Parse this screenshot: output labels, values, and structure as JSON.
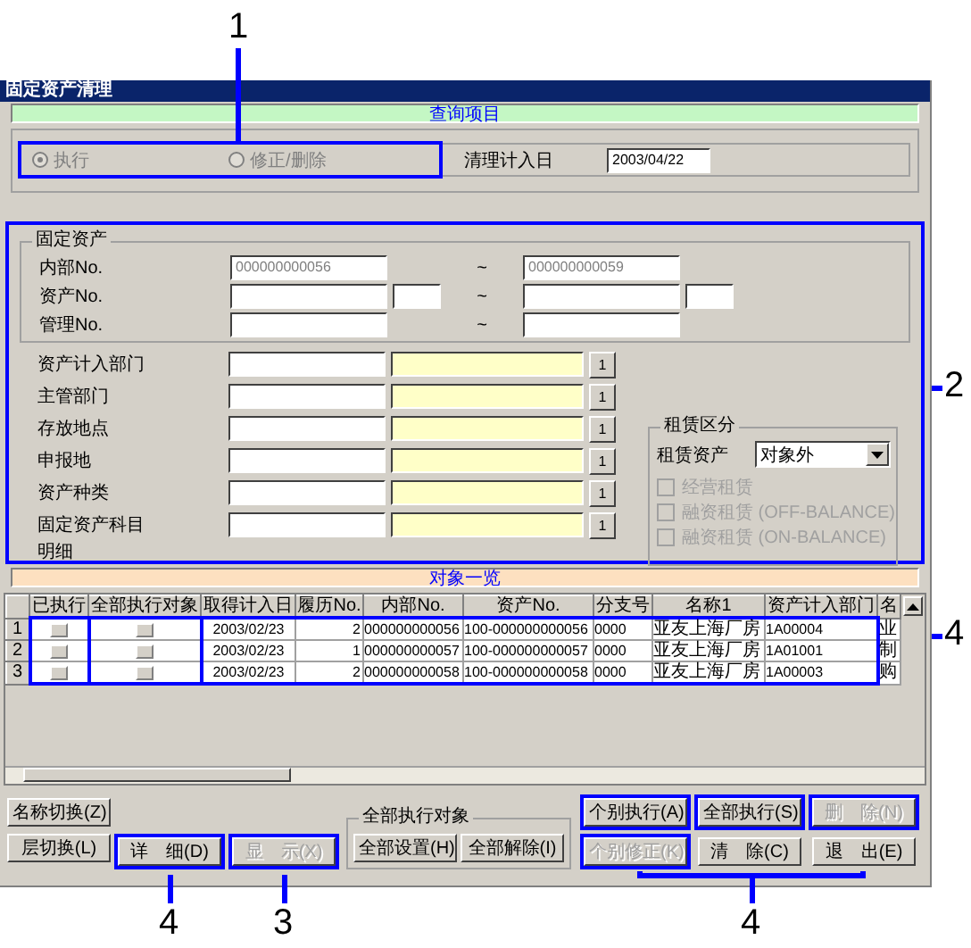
{
  "window": {
    "title": "固定资产清理"
  },
  "query_header": "查询项目",
  "mode_options": [
    {
      "label": "执行",
      "selected": true,
      "disabled": true
    },
    {
      "label": "修正/删除",
      "selected": false,
      "disabled": true
    }
  ],
  "clear_date": {
    "label": "清理计入日",
    "value": "2003/04/22"
  },
  "fixed_asset": {
    "title": "固定资产",
    "ranges": [
      {
        "kind": "single",
        "label": "内部No.",
        "from": "000000000056",
        "separator": "~",
        "to": "000000000059"
      },
      {
        "kind": "split",
        "label": "资产No.",
        "separator": "~"
      },
      {
        "kind": "single",
        "label": "管理No.",
        "separator": "~"
      }
    ]
  },
  "lookups": [
    {
      "label": "资产计入部门",
      "button": "1"
    },
    {
      "label": "主管部门",
      "button": "1"
    },
    {
      "label": "存放地点",
      "button": "1"
    },
    {
      "label": "申报地",
      "button": "1"
    },
    {
      "label": "资产种类",
      "button": "1"
    },
    {
      "label": "固定资产科目",
      "button": "1"
    }
  ],
  "detail_label": "明细",
  "lease": {
    "title": "租赁区分",
    "label": "租赁资产",
    "value": "对象外",
    "options": [
      {
        "label": "经营租赁",
        "checked": false,
        "disabled": true
      },
      {
        "label": "融资租赁 (OFF-BALANCE)",
        "checked": false,
        "disabled": true
      },
      {
        "label": "融资租赁 (ON-BALANCE)",
        "checked": false,
        "disabled": true
      }
    ]
  },
  "list_header": "对象一览",
  "table": {
    "columns": [
      "已执行",
      "全部执行对象",
      "取得计入日",
      "履历No.",
      "内部No.",
      "资产No.",
      "分支号",
      "名称1",
      "资产计入部门",
      "名"
    ],
    "rows": [
      {
        "number": "1",
        "cells": [
          {
            "kind": "check",
            "checked": false
          },
          {
            "kind": "check",
            "checked": false
          },
          {
            "kind": "text",
            "text": "2003/02/23"
          },
          {
            "kind": "text",
            "text": "2"
          },
          {
            "kind": "text",
            "text": "000000000056"
          },
          {
            "kind": "text",
            "text": "100-000000000056"
          },
          {
            "kind": "text",
            "text": "0000"
          },
          {
            "kind": "text",
            "text": "亚友上海厂房"
          },
          {
            "kind": "text",
            "text": "1A00004"
          },
          {
            "kind": "text",
            "text": "业"
          }
        ]
      },
      {
        "number": "2",
        "cells": [
          {
            "kind": "check",
            "checked": false
          },
          {
            "kind": "check",
            "checked": false
          },
          {
            "kind": "text",
            "text": "2003/02/23"
          },
          {
            "kind": "text",
            "text": "1"
          },
          {
            "kind": "text",
            "text": "000000000057"
          },
          {
            "kind": "text",
            "text": "100-000000000057"
          },
          {
            "kind": "text",
            "text": "0000"
          },
          {
            "kind": "text",
            "text": "亚友上海厂房"
          },
          {
            "kind": "text",
            "text": "1A01001"
          },
          {
            "kind": "text",
            "text": "制"
          }
        ]
      },
      {
        "number": "3",
        "cells": [
          {
            "kind": "check",
            "checked": false
          },
          {
            "kind": "check",
            "checked": false
          },
          {
            "kind": "text",
            "text": "2003/02/23"
          },
          {
            "kind": "text",
            "text": "2"
          },
          {
            "kind": "text",
            "text": "000000000058"
          },
          {
            "kind": "text",
            "text": "100-000000000058"
          },
          {
            "kind": "text",
            "text": "0000"
          },
          {
            "kind": "text",
            "text": "亚友上海厂房"
          },
          {
            "kind": "text",
            "text": "1A00003"
          },
          {
            "kind": "text",
            "text": "购"
          }
        ]
      }
    ]
  },
  "nav_buttons": [
    {
      "label": "名称切换(Z)",
      "disabled": false
    },
    {
      "label": "层切换(L)",
      "disabled": false
    }
  ],
  "view_buttons": [
    {
      "label": "详　细(D)",
      "disabled": false
    },
    {
      "label": "显　示(X)",
      "disabled": true
    }
  ],
  "all_target_group": {
    "title": "全部执行对象",
    "buttons": [
      {
        "label": "全部设置(H)",
        "disabled": false
      },
      {
        "label": "全部解除(I)",
        "disabled": false
      }
    ]
  },
  "action_buttons": [
    {
      "label": "个别执行(A)",
      "disabled": false
    },
    {
      "label": "全部执行(S)",
      "disabled": false
    },
    {
      "label": "删　除(N)",
      "disabled": true
    },
    {
      "label": "个别修正(K)",
      "disabled": true
    },
    {
      "label": "清　除(C)",
      "disabled": false
    },
    {
      "label": "退　出(E)",
      "disabled": false
    }
  ],
  "callouts": [
    {
      "number": "1"
    },
    {
      "number": "2"
    },
    {
      "number": "4"
    },
    {
      "number": "4"
    },
    {
      "number": "3"
    },
    {
      "number": "4"
    }
  ]
}
